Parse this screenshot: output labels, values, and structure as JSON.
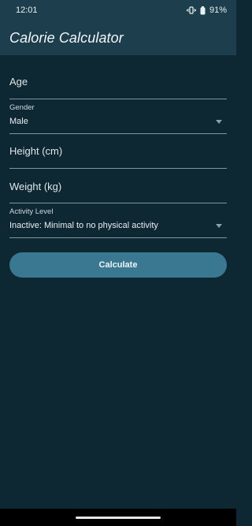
{
  "status_bar": {
    "time": "12:01",
    "battery": "91%"
  },
  "app_bar": {
    "title": "Calorie Calculator"
  },
  "form": {
    "age": {
      "label": "Age"
    },
    "gender": {
      "label": "Gender",
      "value": "Male"
    },
    "height": {
      "label": "Height (cm)"
    },
    "weight": {
      "label": "Weight (kg)"
    },
    "activity": {
      "label": "Activity Level",
      "value": "Inactive: Minimal to no physical activity"
    }
  },
  "button": {
    "calculate_label": "Calculate"
  },
  "colors": {
    "background": "#0d2733",
    "app_bar": "#1c3e4d",
    "button": "#3a7892",
    "divider": "#7f96a0"
  },
  "icons": {
    "vibrate": "vibrate-icon",
    "battery": "battery-icon",
    "dropdown": "chevron-down-icon"
  }
}
